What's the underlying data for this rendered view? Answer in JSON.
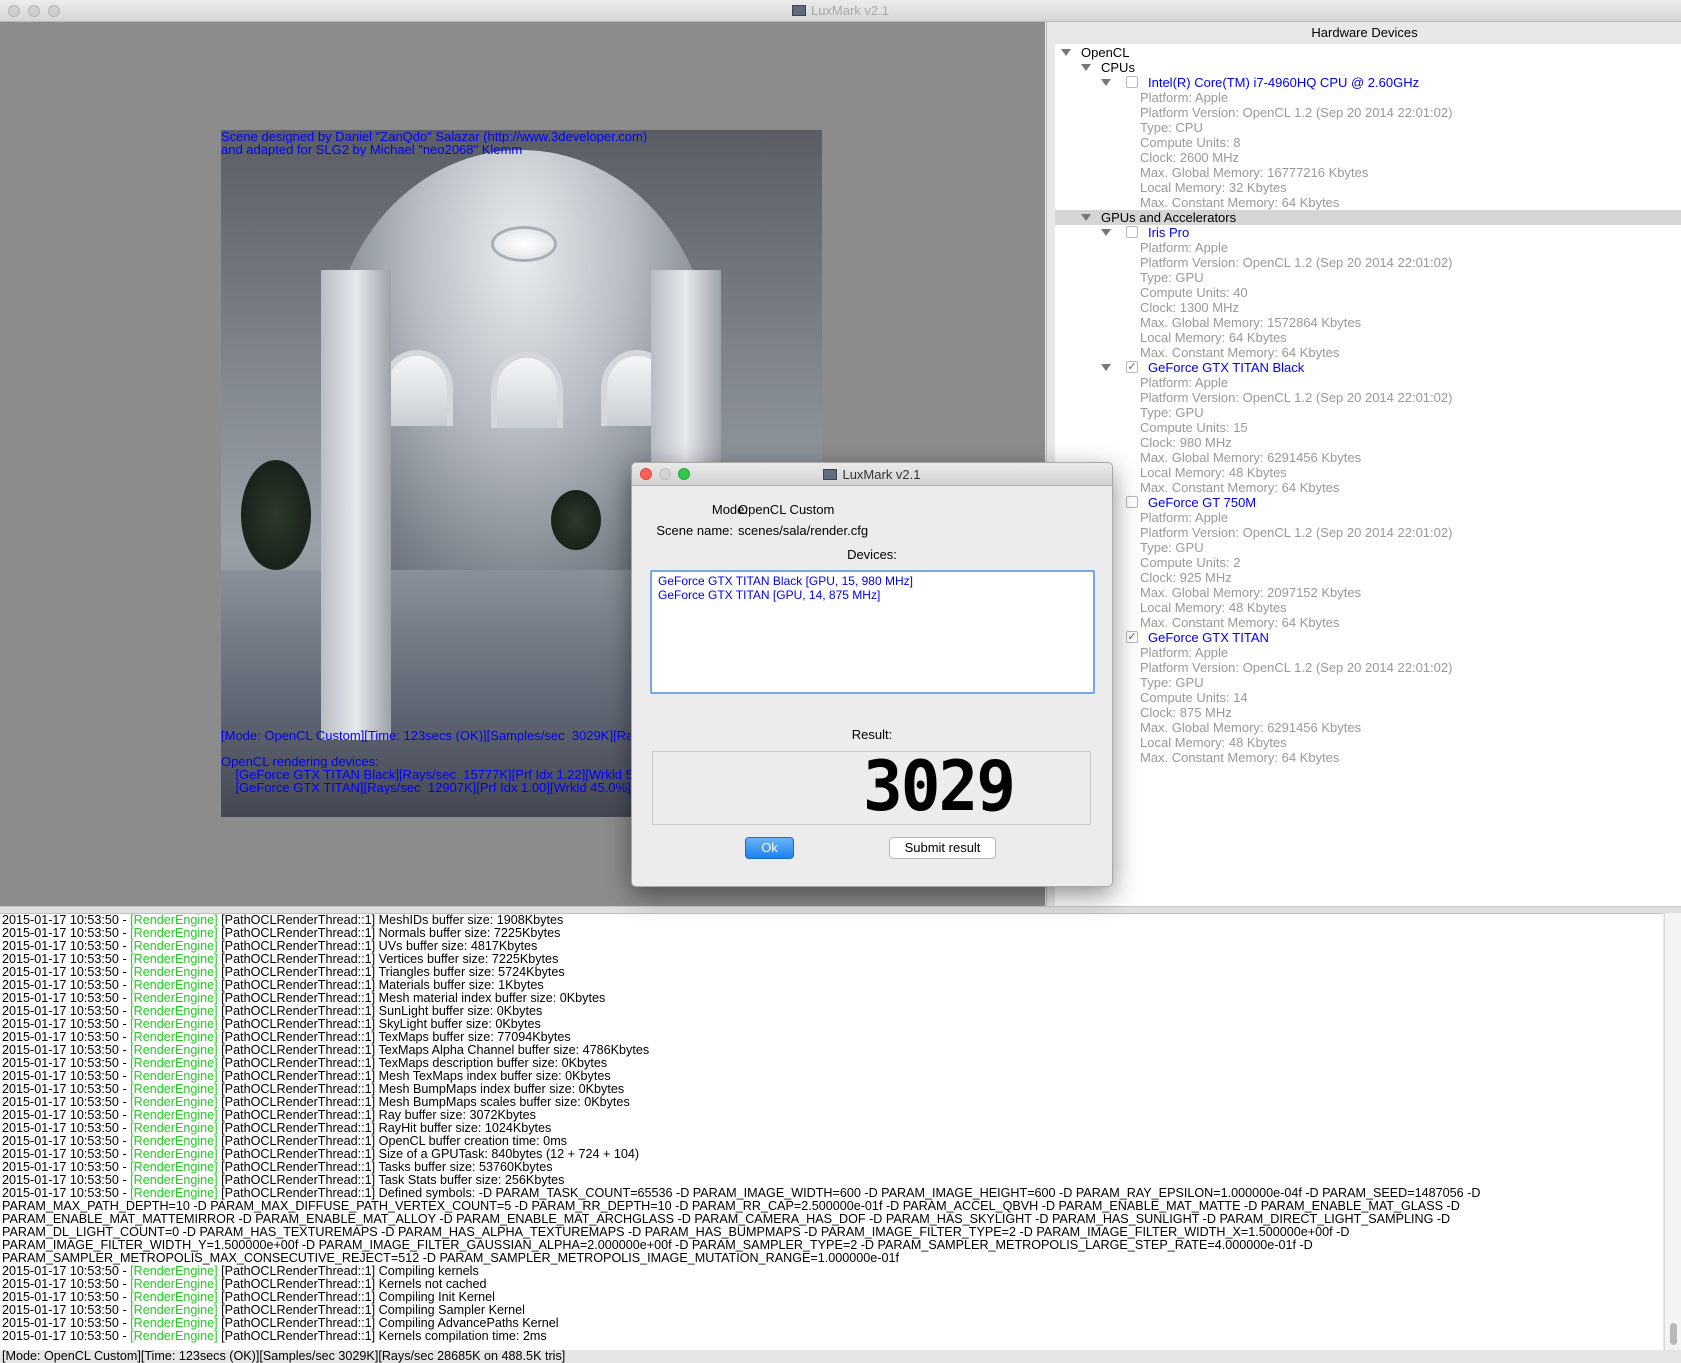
{
  "window": {
    "title": "LuxMark v2.1"
  },
  "render": {
    "credit_line1": "Scene designed by Daniel \"ZanQdo\" Salazar (http://www.3developer.com)",
    "credit_line2": "and adapted for SLG2 by Michael \"neo2068\" Klemm",
    "stats_line": "[Mode: OpenCL Custom][Time: 123secs (OK)][Samples/sec  3029K][Ra",
    "devices_heading": "OpenCL rendering devices:",
    "device_line1": "    [GeForce GTX TITAN Black][Rays/sec  15777K][Prf Idx 1.22][Wrkld 5",
    "device_line2": "    [GeForce GTX TITAN][Rays/sec  12907K][Prf Idx 1.00][Wrkld 45.0%]"
  },
  "hardware": {
    "header": "Hardware Devices",
    "root": "OpenCL",
    "cpus_group": "CPUs",
    "gpus_group": "GPUs and Accelerators",
    "devices": [
      {
        "name": "Intel(R) Core(TM) i7-4960HQ CPU @ 2.60GHz",
        "checked": false,
        "props": [
          "Platform: Apple",
          "Platform Version: OpenCL 1.2 (Sep 20 2014 22:01:02)",
          "Type: CPU",
          "Compute Units: 8",
          "Clock: 2600 MHz",
          "Max. Global Memory: 16777216 Kbytes",
          "Local Memory: 32 Kbytes",
          "Max. Constant Memory: 64 Kbytes"
        ]
      },
      {
        "name": "Iris Pro",
        "checked": false,
        "props": [
          "Platform: Apple",
          "Platform Version: OpenCL 1.2 (Sep 20 2014 22:01:02)",
          "Type: GPU",
          "Compute Units: 40",
          "Clock: 1300 MHz",
          "Max. Global Memory: 1572864 Kbytes",
          "Local Memory: 64 Kbytes",
          "Max. Constant Memory: 64 Kbytes"
        ]
      },
      {
        "name": "GeForce GTX TITAN Black",
        "checked": true,
        "props": [
          "Platform: Apple",
          "Platform Version: OpenCL 1.2 (Sep 20 2014 22:01:02)",
          "Type: GPU",
          "Compute Units: 15",
          "Clock: 980 MHz",
          "Max. Global Memory: 6291456 Kbytes",
          "Local Memory: 48 Kbytes",
          "Max. Constant Memory: 64 Kbytes"
        ]
      },
      {
        "name": "GeForce GT 750M",
        "checked": false,
        "props": [
          "Platform: Apple",
          "Platform Version: OpenCL 1.2 (Sep 20 2014 22:01:02)",
          "Type: GPU",
          "Compute Units: 2",
          "Clock: 925 MHz",
          "Max. Global Memory: 2097152 Kbytes",
          "Local Memory: 48 Kbytes",
          "Max. Constant Memory: 64 Kbytes"
        ]
      },
      {
        "name": "GeForce GTX TITAN",
        "checked": true,
        "props": [
          "Platform: Apple",
          "Platform Version: OpenCL 1.2 (Sep 20 2014 22:01:02)",
          "Type: GPU",
          "Compute Units: 14",
          "Clock: 875 MHz",
          "Max. Global Memory: 6291456 Kbytes",
          "Local Memory: 48 Kbytes",
          "Max. Constant Memory: 64 Kbytes"
        ]
      }
    ]
  },
  "dialog": {
    "title": "LuxMark v2.1",
    "mode_label": "Mode:",
    "mode_value": "OpenCL Custom",
    "scene_label": "Scene name:",
    "scene_value": "scenes/sala/render.cfg",
    "devices_label": "Devices:",
    "devices": [
      "GeForce GTX TITAN Black [GPU, 15, 980 MHz]",
      "GeForce GTX TITAN [GPU, 14, 875 MHz]"
    ],
    "result_label": "Result:",
    "result_value": "3029",
    "ok_label": "Ok",
    "submit_label": "Submit result"
  },
  "log": {
    "lines": [
      {
        "ts": "2015-01-17 10:53:50 - ",
        "tag": "[RenderEngine]",
        "msg": " [PathOCLRenderThread::1] MeshIDs buffer size: 1908Kbytes"
      },
      {
        "ts": "2015-01-17 10:53:50 - ",
        "tag": "[RenderEngine]",
        "msg": " [PathOCLRenderThread::1] Normals buffer size: 7225Kbytes"
      },
      {
        "ts": "2015-01-17 10:53:50 - ",
        "tag": "[RenderEngine]",
        "msg": " [PathOCLRenderThread::1] UVs buffer size: 4817Kbytes"
      },
      {
        "ts": "2015-01-17 10:53:50 - ",
        "tag": "[RenderEngine]",
        "msg": " [PathOCLRenderThread::1] Vertices buffer size: 7225Kbytes"
      },
      {
        "ts": "2015-01-17 10:53:50 - ",
        "tag": "[RenderEngine]",
        "msg": " [PathOCLRenderThread::1] Triangles buffer size: 5724Kbytes"
      },
      {
        "ts": "2015-01-17 10:53:50 - ",
        "tag": "[RenderEngine]",
        "msg": " [PathOCLRenderThread::1] Materials buffer size: 1Kbytes"
      },
      {
        "ts": "2015-01-17 10:53:50 - ",
        "tag": "[RenderEngine]",
        "msg": " [PathOCLRenderThread::1] Mesh material index buffer size: 0Kbytes"
      },
      {
        "ts": "2015-01-17 10:53:50 - ",
        "tag": "[RenderEngine]",
        "msg": " [PathOCLRenderThread::1] SunLight buffer size: 0Kbytes"
      },
      {
        "ts": "2015-01-17 10:53:50 - ",
        "tag": "[RenderEngine]",
        "msg": " [PathOCLRenderThread::1] SkyLight buffer size: 0Kbytes"
      },
      {
        "ts": "2015-01-17 10:53:50 - ",
        "tag": "[RenderEngine]",
        "msg": " [PathOCLRenderThread::1] TexMaps buffer size: 77094Kbytes"
      },
      {
        "ts": "2015-01-17 10:53:50 - ",
        "tag": "[RenderEngine]",
        "msg": " [PathOCLRenderThread::1] TexMaps Alpha Channel buffer size: 4786Kbytes"
      },
      {
        "ts": "2015-01-17 10:53:50 - ",
        "tag": "[RenderEngine]",
        "msg": " [PathOCLRenderThread::1] TexMaps description buffer size: 0Kbytes"
      },
      {
        "ts": "2015-01-17 10:53:50 - ",
        "tag": "[RenderEngine]",
        "msg": " [PathOCLRenderThread::1] Mesh TexMaps index buffer size: 0Kbytes"
      },
      {
        "ts": "2015-01-17 10:53:50 - ",
        "tag": "[RenderEngine]",
        "msg": " [PathOCLRenderThread::1] Mesh BumpMaps index buffer size: 0Kbytes"
      },
      {
        "ts": "2015-01-17 10:53:50 - ",
        "tag": "[RenderEngine]",
        "msg": " [PathOCLRenderThread::1] Mesh BumpMaps scales buffer size: 0Kbytes"
      },
      {
        "ts": "2015-01-17 10:53:50 - ",
        "tag": "[RenderEngine]",
        "msg": " [PathOCLRenderThread::1] Ray buffer size: 3072Kbytes"
      },
      {
        "ts": "2015-01-17 10:53:50 - ",
        "tag": "[RenderEngine]",
        "msg": " [PathOCLRenderThread::1] RayHit buffer size: 1024Kbytes"
      },
      {
        "ts": "2015-01-17 10:53:50 - ",
        "tag": "[RenderEngine]",
        "msg": " [PathOCLRenderThread::1] OpenCL buffer creation time: 0ms"
      },
      {
        "ts": "2015-01-17 10:53:50 - ",
        "tag": "[RenderEngine]",
        "msg": " [PathOCLRenderThread::1] Size of a GPUTask: 840bytes (12 + 724 + 104)"
      },
      {
        "ts": "2015-01-17 10:53:50 - ",
        "tag": "[RenderEngine]",
        "msg": " [PathOCLRenderThread::1] Tasks buffer size: 53760Kbytes"
      },
      {
        "ts": "2015-01-17 10:53:50 - ",
        "tag": "[RenderEngine]",
        "msg": " [PathOCLRenderThread::1] Task Stats buffer size: 256Kbytes"
      },
      {
        "ts": "2015-01-17 10:53:50 - ",
        "tag": "[RenderEngine]",
        "msg": " [PathOCLRenderThread::1] Defined symbols: -D PARAM_TASK_COUNT=65536 -D PARAM_IMAGE_WIDTH=600 -D PARAM_IMAGE_HEIGHT=600 -D PARAM_RAY_EPSILON=1.000000e-04f -D PARAM_SEED=1487056 -D"
      },
      {
        "ts": "",
        "tag": "",
        "msg": "PARAM_MAX_PATH_DEPTH=10 -D PARAM_MAX_DIFFUSE_PATH_VERTEX_COUNT=5 -D PARAM_RR_DEPTH=10 -D PARAM_RR_CAP=2.500000e-01f -D PARAM_ACCEL_QBVH -D PARAM_ENABLE_MAT_MATTE -D PARAM_ENABLE_MAT_GLASS -D"
      },
      {
        "ts": "",
        "tag": "",
        "msg": "PARAM_ENABLE_MAT_MATTEMIRROR -D PARAM_ENABLE_MAT_ALLOY -D PARAM_ENABLE_MAT_ARCHGLASS -D PARAM_CAMERA_HAS_DOF -D PARAM_HAS_SKYLIGHT -D PARAM_HAS_SUNLIGHT -D PARAM_DIRECT_LIGHT_SAMPLING -D"
      },
      {
        "ts": "",
        "tag": "",
        "msg": "PARAM_DL_LIGHT_COUNT=0 -D PARAM_HAS_TEXTUREMAPS -D PARAM_HAS_ALPHA_TEXTUREMAPS -D PARAM_HAS_BUMPMAPS -D PARAM_IMAGE_FILTER_TYPE=2 -D PARAM_IMAGE_FILTER_WIDTH_X=1.500000e+00f -D"
      },
      {
        "ts": "",
        "tag": "",
        "msg": "PARAM_IMAGE_FILTER_WIDTH_Y=1.500000e+00f -D PARAM_IMAGE_FILTER_GAUSSIAN_ALPHA=2.000000e+00f -D PARAM_SAMPLER_TYPE=2 -D PARAM_SAMPLER_METROPOLIS_LARGE_STEP_RATE=4.000000e-01f -D"
      },
      {
        "ts": "",
        "tag": "",
        "msg": "PARAM_SAMPLER_METROPOLIS_MAX_CONSECUTIVE_REJECT=512 -D PARAM_SAMPLER_METROPOLIS_IMAGE_MUTATION_RANGE=1.000000e-01f"
      },
      {
        "ts": "2015-01-17 10:53:50 - ",
        "tag": "[RenderEngine]",
        "msg": " [PathOCLRenderThread::1] Compiling kernels"
      },
      {
        "ts": "2015-01-17 10:53:50 - ",
        "tag": "[RenderEngine]",
        "msg": " [PathOCLRenderThread::1] Kernels not cached"
      },
      {
        "ts": "2015-01-17 10:53:50 - ",
        "tag": "[RenderEngine]",
        "msg": " [PathOCLRenderThread::1] Compiling Init Kernel"
      },
      {
        "ts": "2015-01-17 10:53:50 - ",
        "tag": "[RenderEngine]",
        "msg": " [PathOCLRenderThread::1] Compiling Sampler Kernel"
      },
      {
        "ts": "2015-01-17 10:53:50 - ",
        "tag": "[RenderEngine]",
        "msg": " [PathOCLRenderThread::1] Compiling AdvancePaths Kernel"
      },
      {
        "ts": "2015-01-17 10:53:50 - ",
        "tag": "[RenderEngine]",
        "msg": " [PathOCLRenderThread::1] Kernels compilation time: 2ms"
      }
    ]
  },
  "status": {
    "text": "[Mode: OpenCL Custom][Time: 123secs (OK)][Samples/sec  3029K][Rays/sec  28685K on 488.5K tris]"
  }
}
